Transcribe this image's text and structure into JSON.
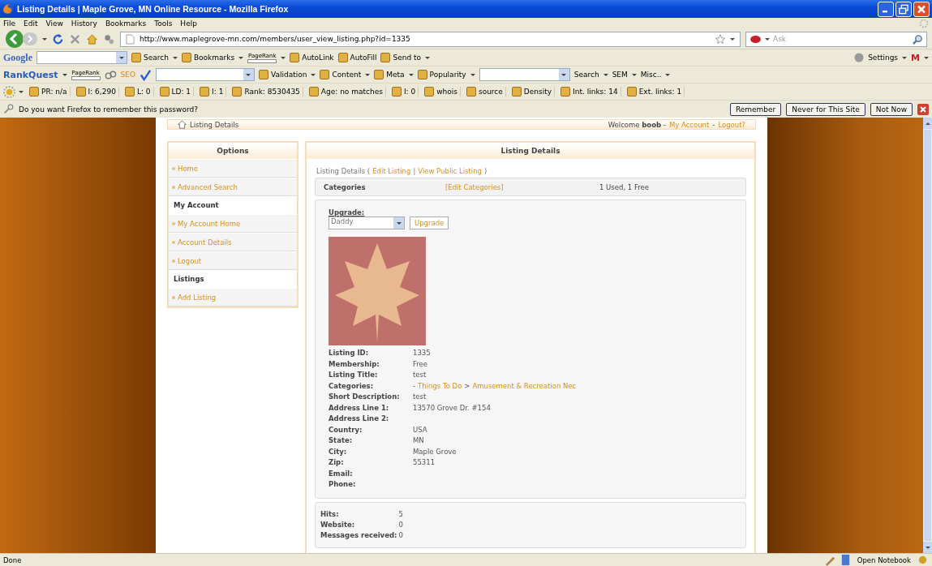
{
  "window": {
    "title": "Listing Details | Maple Grove, MN Online Resource - Mozilla Firefox"
  },
  "menu": [
    "File",
    "Edit",
    "View",
    "History",
    "Bookmarks",
    "Tools",
    "Help"
  ],
  "navigation": {
    "url": "http://www.maplegrove-mn.com/members/user_view_listing.php?id=1335",
    "search_placeholder": "Ask"
  },
  "google_toolbar": {
    "logo": "Google",
    "items": [
      {
        "label": "Search",
        "has_menu": true
      },
      {
        "label": "Bookmarks",
        "has_menu": true
      },
      {
        "label": "PageRank",
        "kind": "pagerank",
        "has_menu": true
      },
      {
        "label": "AutoLink",
        "has_menu": false
      },
      {
        "label": "AutoFill",
        "has_menu": false
      },
      {
        "label": "Send to",
        "has_menu": true
      }
    ],
    "right": [
      {
        "label": "Settings",
        "has_menu": true
      },
      {
        "label": "M",
        "has_menu": true
      }
    ]
  },
  "rankquest_toolbar": {
    "logo": "RankQuest",
    "pagerank": "PageRank",
    "seo": "SEO",
    "items": [
      {
        "label": "Validation",
        "has_menu": true
      },
      {
        "label": "Content",
        "has_menu": true
      },
      {
        "label": "Meta",
        "has_menu": true
      },
      {
        "label": "Popularity",
        "has_menu": true
      }
    ],
    "right": [
      {
        "label": "Search",
        "has_menu": true
      },
      {
        "label": "SEM",
        "has_menu": true
      },
      {
        "label": "Misc..",
        "has_menu": true
      }
    ]
  },
  "seo_toolbar": [
    "PR: n/a",
    "I: 6,290",
    "L: 0",
    "LD: 1",
    "I: 1",
    "Rank: 8530435",
    "Age: no matches",
    "I: 0",
    "whois",
    "source",
    "Density",
    "Int. links: 14",
    "Ext. links: 1"
  ],
  "password_bar": {
    "message": "Do you want Firefox to remember this password?",
    "buttons": [
      "Remember",
      "Never for This Site",
      "Not Now"
    ]
  },
  "page": {
    "breadcrumb": "Listing Details",
    "welcome": "Welcome **boob** -",
    "account_links": [
      "My Account",
      "Logout?"
    ],
    "link_separator": "-",
    "sidebar": {
      "title": "Options",
      "items": [
        {
          "label": "Home",
          "kind": "link"
        },
        {
          "label": "Advanced Search",
          "kind": "link"
        },
        {
          "label": "My Account",
          "kind": "heading"
        },
        {
          "label": "My Account Home",
          "kind": "link"
        },
        {
          "label": "Account Details",
          "kind": "link"
        },
        {
          "label": "Logout",
          "kind": "link"
        },
        {
          "label": "Listings",
          "kind": "heading"
        },
        {
          "label": "Add Listing",
          "kind": "link"
        }
      ]
    },
    "main": {
      "title": "Listing Details",
      "subnav_prefix": "Listing Details (",
      "subnav_links": [
        "Edit Listing",
        "View Public Listing"
      ],
      "subnav_separator": "|",
      "subnav_suffix": ")",
      "categories": {
        "label": "Categories",
        "link": "[Edit Categories]",
        "value": "1 Used, 1 Free"
      },
      "upgrade": {
        "label": "Upgrade:",
        "selected": "Daddy",
        "button": "Upgrade"
      },
      "details": [
        {
          "label": "Listing ID:",
          "kind": "text",
          "value": "1335"
        },
        {
          "label": "Membership:",
          "kind": "text",
          "value": "Free"
        },
        {
          "label": "Listing Title:",
          "kind": "text",
          "value": "test"
        },
        {
          "label": "Categories:",
          "kind": "links",
          "prefix": "-",
          "links": [
            "Things To Do",
            "Amusement & Recreation Nec"
          ],
          "separator": ">"
        },
        {
          "label": "Short Description:",
          "kind": "text",
          "value": "test"
        },
        {
          "label": "Address Line 1:",
          "kind": "text",
          "value": "13570 Grove Dr. #154"
        },
        {
          "label": "Address Line 2:",
          "kind": "text"
        },
        {
          "label": "Country:",
          "kind": "text",
          "value": "USA"
        },
        {
          "label": "State:",
          "kind": "text",
          "value": "MN"
        },
        {
          "label": "City:",
          "kind": "text",
          "value": "Maple Grove"
        },
        {
          "label": "Zip:",
          "kind": "text",
          "value": "55311"
        },
        {
          "label": "Email:",
          "kind": "text"
        },
        {
          "label": "Phone:",
          "kind": "text"
        }
      ],
      "stats": [
        {
          "label": "Hits:",
          "value": "5"
        },
        {
          "label": "Website:",
          "value": "0"
        },
        {
          "label": "Messages received:",
          "value": "0"
        }
      ]
    }
  },
  "status_bar": {
    "text": "Done",
    "notebook": "Open Notebook"
  }
}
